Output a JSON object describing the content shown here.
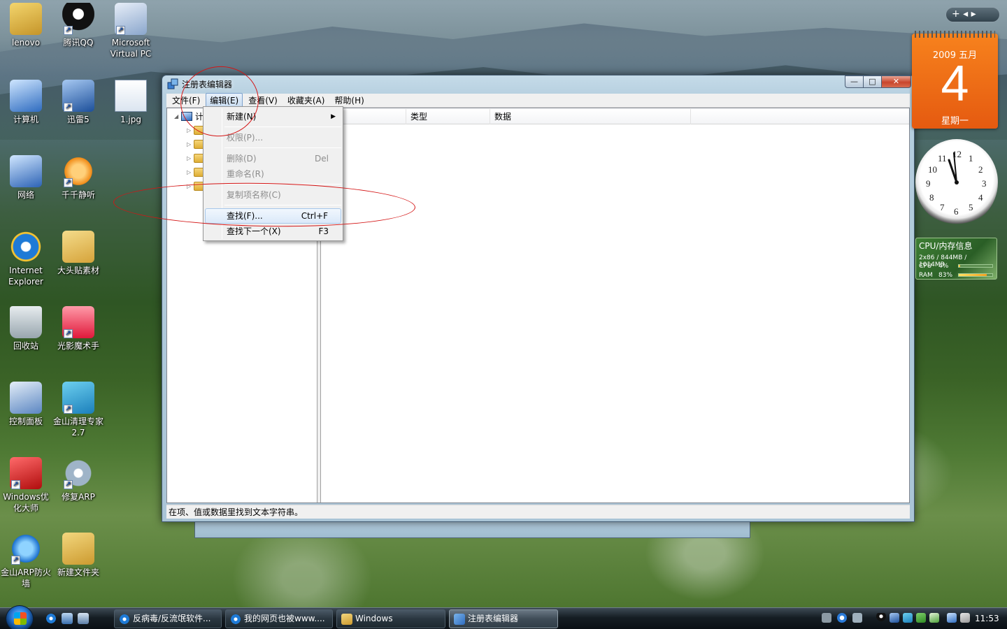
{
  "desktop_icons": [
    {
      "label": "lenovo"
    },
    {
      "label": "腾讯QQ"
    },
    {
      "label": "Microsoft Virtual PC"
    },
    {
      "label": "计算机"
    },
    {
      "label": "迅雷5"
    },
    {
      "label": "1.jpg"
    },
    {
      "label": "网络"
    },
    {
      "label": "千千静听"
    },
    {
      "label": "Internet Explorer"
    },
    {
      "label": "大头贴素材"
    },
    {
      "label": "回收站"
    },
    {
      "label": "光影魔术手"
    },
    {
      "label": "控制面板"
    },
    {
      "label": "金山清理专家 2.7"
    },
    {
      "label": "Windows优化大师"
    },
    {
      "label": "修复ARP"
    },
    {
      "label": "金山ARP防火墙"
    },
    {
      "label": "新建文件夹"
    }
  ],
  "regedit": {
    "title": "注册表编辑器",
    "buttons": {
      "minimize": "—",
      "maximize": "□",
      "close": "✕"
    },
    "menus": [
      {
        "label": "文件(F)"
      },
      {
        "label": "编辑(E)"
      },
      {
        "label": "查看(V)"
      },
      {
        "label": "收藏夹(A)"
      },
      {
        "label": "帮助(H)"
      }
    ],
    "columns": [
      {
        "label": ""
      },
      {
        "label": "类型"
      },
      {
        "label": "数据"
      }
    ],
    "tree_root_label": "计",
    "status": "在项、值或数据里找到文本字符串。"
  },
  "edit_menu": {
    "items": [
      {
        "label": "新建(N)",
        "shortcut": "",
        "disabled": false,
        "submenu": true
      },
      {
        "label": "权限(P)...",
        "shortcut": "",
        "disabled": true
      },
      {
        "label": "删除(D)",
        "shortcut": "Del",
        "disabled": true
      },
      {
        "label": "重命名(R)",
        "shortcut": "",
        "disabled": true
      },
      {
        "label": "复制项名称(C)",
        "shortcut": "",
        "disabled": true
      },
      {
        "label": "查找(F)...",
        "shortcut": "Ctrl+F",
        "disabled": false,
        "highlighted": true
      },
      {
        "label": "查找下一个(X)",
        "shortcut": "F3",
        "disabled": false
      }
    ]
  },
  "gadgets": {
    "calendar": {
      "month": "2009 五月",
      "day": "4",
      "weekday": "星期一"
    },
    "clock": {
      "numbers": [
        "12",
        "1",
        "2",
        "3",
        "4",
        "5",
        "6",
        "7",
        "8",
        "9",
        "10",
        "11"
      ]
    },
    "cpu": {
      "title": "CPU/内存信息",
      "line1": "2x86 / 844MB / 1014MB",
      "cpu_label": "CPU",
      "cpu_value": "4%",
      "cpu_fraction": 0.04,
      "ram_label": "RAM",
      "ram_value": "83%",
      "ram_fraction": 0.83
    },
    "sidebar_controls": "+   ◂ ▸"
  },
  "taskbar": {
    "buttons": [
      {
        "label": "反病毒/反流氓软件..."
      },
      {
        "label": "我的网页也被www...."
      },
      {
        "label": "Windows"
      },
      {
        "label": "注册表编辑器"
      }
    ],
    "time": "11:53"
  }
}
